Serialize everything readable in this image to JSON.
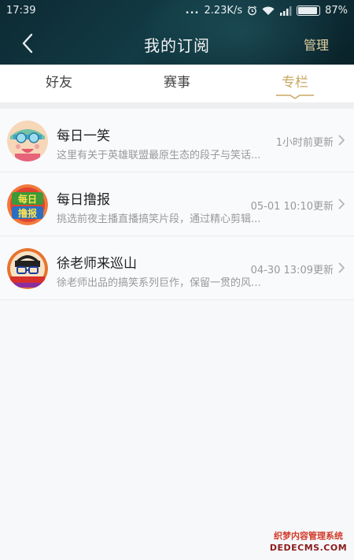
{
  "status_bar": {
    "time": "17:39",
    "dots": "...",
    "network_speed": "2.23K/s",
    "battery_percent": "87%",
    "battery_level": 0.87,
    "icons": [
      "alarm-icon",
      "wifi-icon",
      "signal-icon",
      "battery-icon"
    ]
  },
  "header": {
    "title": "我的订阅",
    "manage_label": "管理",
    "back_icon": "back-arrow-icon"
  },
  "tabs": [
    {
      "label": "好友",
      "active": false
    },
    {
      "label": "赛事",
      "active": false
    },
    {
      "label": "专栏",
      "active": true
    }
  ],
  "subscriptions": [
    {
      "title": "每日一笑",
      "description": "这里有关于英雄联盟最原生态的段子与笑话...",
      "updated": "1小时前更新"
    },
    {
      "title": "每日撸报",
      "description": "挑选前夜主播直播搞笑片段，通过精心剪辑...",
      "updated": "05-01 10:10更新"
    },
    {
      "title": "徐老师来巡山",
      "description": "徐老师出品的搞笑系列巨作，保留一贯的风格...",
      "updated": "04-30 13:09更新"
    }
  ],
  "avatar_texts": {
    "daily_report": [
      "每日",
      "撸报"
    ]
  },
  "watermark": {
    "line1": "织梦内容管理系统",
    "line2": "DEDECMS.COM"
  },
  "colors": {
    "header_bg": "#0f3139",
    "accent_gold": "#c9a763",
    "manage_text": "#e6d2a2"
  }
}
